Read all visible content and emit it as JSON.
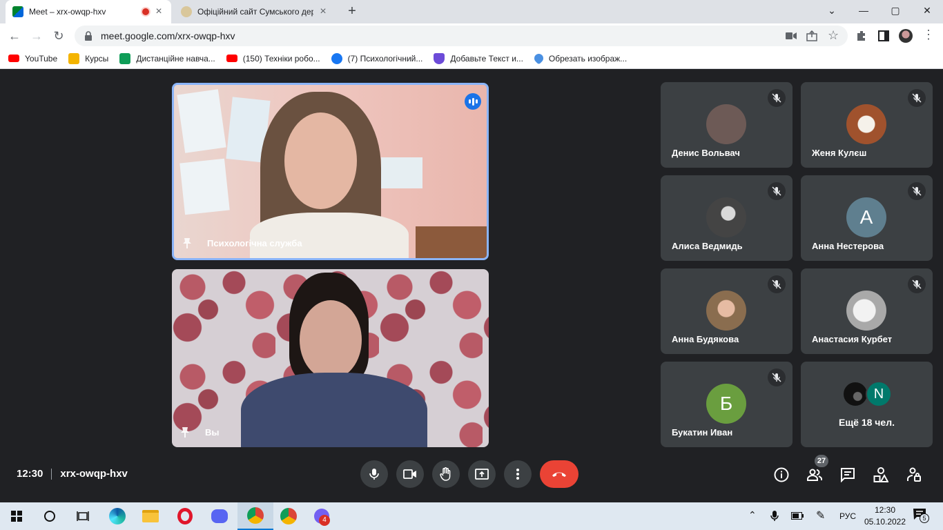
{
  "tabs": [
    {
      "title": "Meet – xrx-owqp-hxv",
      "recording": true
    },
    {
      "title": "Офіційний сайт Сумського держ"
    }
  ],
  "window": {
    "minimize": "—",
    "maximize": "▢",
    "close": "✕",
    "dropdown": "⌄"
  },
  "address": {
    "url": "meet.google.com/xrx-owqp-hxv"
  },
  "bookmarks": [
    {
      "label": "YouTube",
      "icon": "youtube-icon",
      "color": "#ff0000"
    },
    {
      "label": "Курсы",
      "icon": "classroom-icon",
      "color": "#f4b400"
    },
    {
      "label": "Дистанційне навча...",
      "icon": "green-plus-icon",
      "color": "#0f9d58"
    },
    {
      "label": "(150) Техніки робо...",
      "icon": "youtube-icon",
      "color": "#ff0000"
    },
    {
      "label": "(7) Психологічний...",
      "icon": "facebook-icon",
      "color": "#1877f2"
    },
    {
      "label": "Добавьте Текст и...",
      "icon": "shield-icon",
      "color": "#6c4bd8"
    },
    {
      "label": "Обрезать изображ...",
      "icon": "heart-icon",
      "color": "#4a90e2"
    }
  ],
  "main_videos": [
    {
      "name": "Психологічна служба",
      "speaking": true
    },
    {
      "name": "Вы"
    }
  ],
  "participants": [
    {
      "name": "Денис Вольвач",
      "avatar_color": "#6d5a56",
      "initial": ""
    },
    {
      "name": "Женя Кулєш",
      "avatar_color": "#a0522d",
      "initial": ""
    },
    {
      "name": "Алиса Ведмидь",
      "avatar_color": "#555555",
      "initial": ""
    },
    {
      "name": "Анна Нестерова",
      "avatar_color": "#5f7f8f",
      "initial": "А"
    },
    {
      "name": "Анна Будякова",
      "avatar_color": "#8a6d4f",
      "initial": ""
    },
    {
      "name": "Анастасия Курбет",
      "avatar_color": "#cfcfcf",
      "initial": ""
    },
    {
      "name": "Букатин Иван",
      "avatar_color": "#6a9e3f",
      "initial": "Б"
    }
  ],
  "more": {
    "label": "Ещё 18 чел.",
    "avatar_initial": "N",
    "avatar_color": "#00796b"
  },
  "meeting": {
    "time": "12:30",
    "code": "xrx-owqp-hxv"
  },
  "people_count": "27",
  "taskbar": {
    "lang": "РУС",
    "time": "12:30",
    "date": "05.10.2022",
    "notif_count": "5",
    "viber_badge": "4"
  }
}
